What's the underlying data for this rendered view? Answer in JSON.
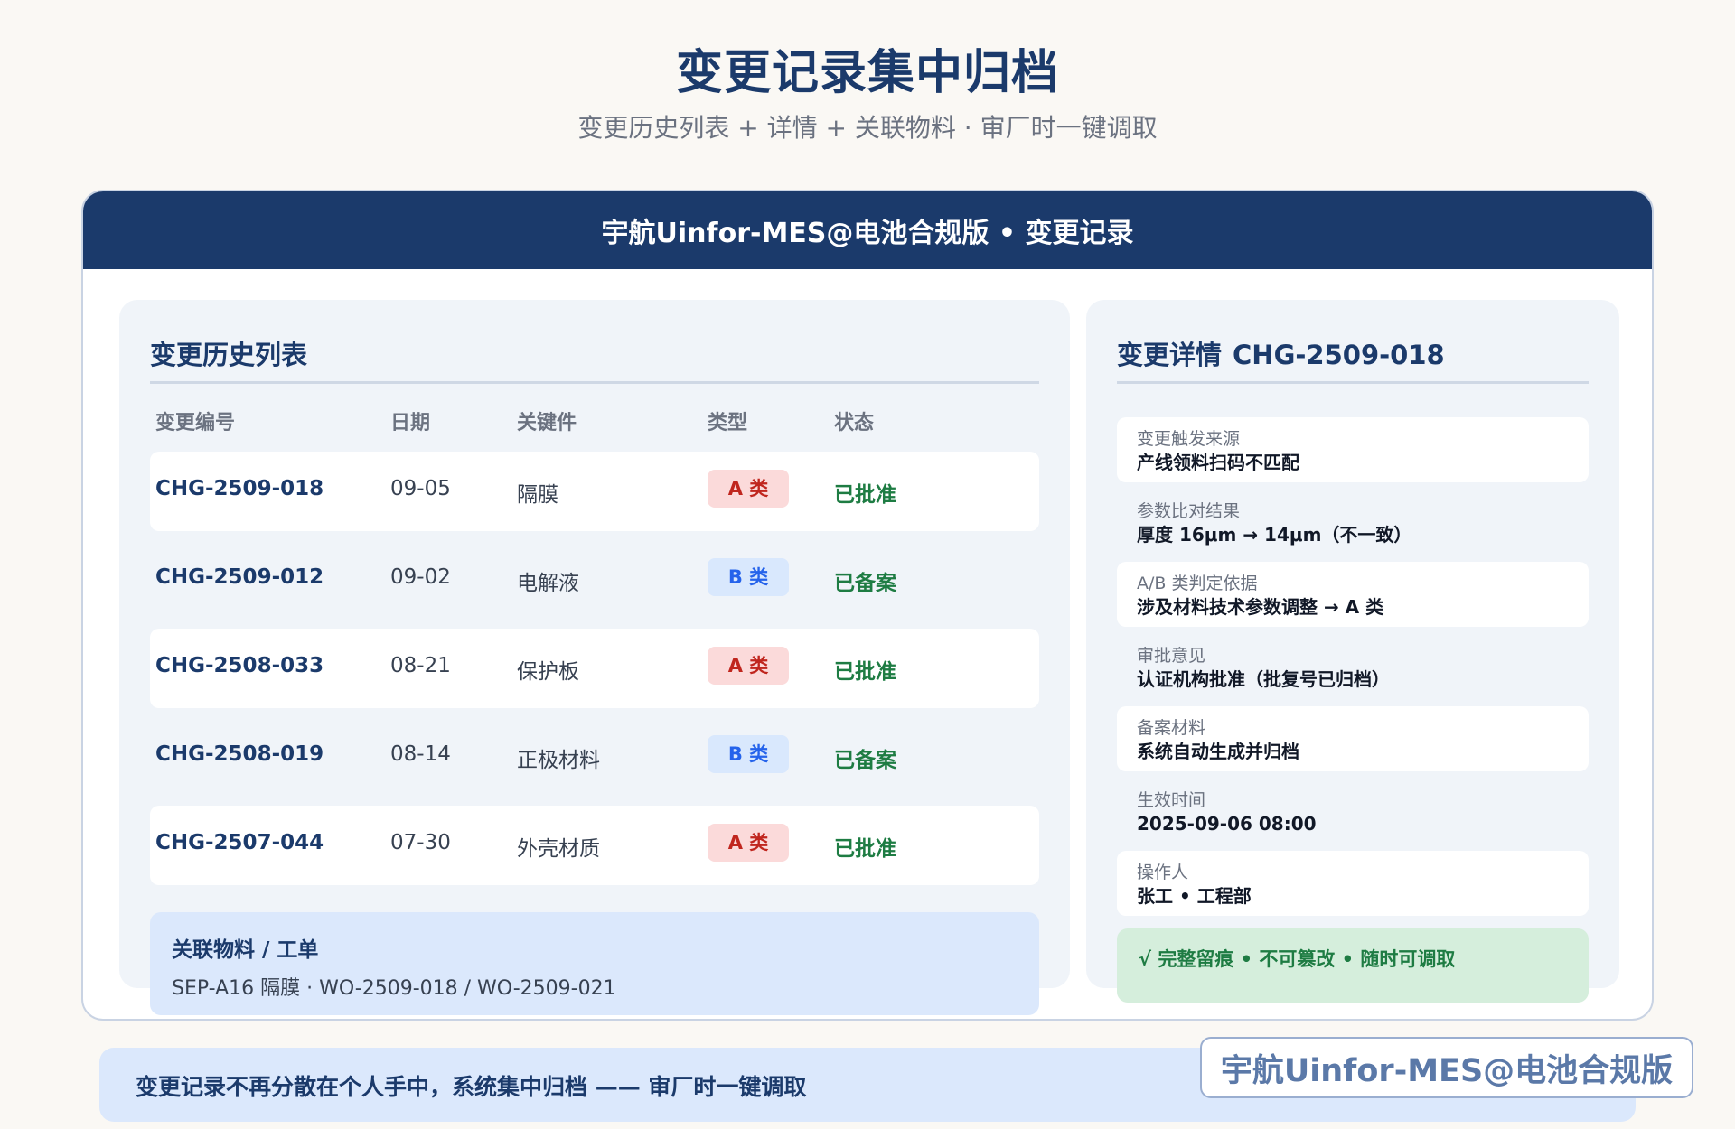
{
  "page": {
    "title": "变更记录集中归档",
    "subtitle": "变更历史列表 + 详情 + 关联物料 · 审厂时一键调取"
  },
  "card": {
    "header": "宇航Uinfor-MES@电池合规版 • 变更记录"
  },
  "history": {
    "title": "变更历史列表",
    "columns": [
      "变更编号",
      "日期",
      "关键件",
      "类型",
      "状态"
    ],
    "rows": [
      {
        "id": "CHG-2509-018",
        "date": "09-05",
        "part": "隔膜",
        "type": "A 类",
        "status": "已批准"
      },
      {
        "id": "CHG-2509-012",
        "date": "09-02",
        "part": "电解液",
        "type": "B 类",
        "status": "已备案"
      },
      {
        "id": "CHG-2508-033",
        "date": "08-21",
        "part": "保护板",
        "type": "A 类",
        "status": "已批准"
      },
      {
        "id": "CHG-2508-019",
        "date": "08-14",
        "part": "正极材料",
        "type": "B 类",
        "status": "已备案"
      },
      {
        "id": "CHG-2507-044",
        "date": "07-30",
        "part": "外壳材质",
        "type": "A 类",
        "status": "已批准"
      }
    ]
  },
  "related": {
    "title": "关联物料 / 工单",
    "text": "SEP-A16 隔膜 · WO-2509-018 / WO-2509-021"
  },
  "detail": {
    "title": "变更详情",
    "code": "CHG-2509-018",
    "items": [
      {
        "label": "变更触发来源",
        "value": "产线领料扫码不匹配"
      },
      {
        "label": "参数比对结果",
        "value": "厚度 16μm → 14μm（不一致）"
      },
      {
        "label": "A/B 类判定依据",
        "value": "涉及材料技术参数调整 → A 类"
      },
      {
        "label": "审批意见",
        "value": "认证机构批准（批复号已归档）"
      },
      {
        "label": "备案材料",
        "value": "系统自动生成并归档"
      },
      {
        "label": "生效时间",
        "value": "2025-09-06 08:00"
      },
      {
        "label": "操作人",
        "value": "张工 • 工程部"
      }
    ],
    "trace": "√ 完整留痕 • 不可篡改 • 随时可调取"
  },
  "footer": {
    "text": "变更记录不再分散在个人手中，系统集中归档 —— 审厂时一键调取",
    "brand": "宇航Uinfor-MES@电池合规版"
  },
  "colors": {
    "primary": "#1b3a6b",
    "type_a_bg": "#fbdada",
    "type_a_text": "#c0261e",
    "type_b_bg": "#d9e8fd",
    "type_b_text": "#2563eb",
    "status_green": "#1e7c43"
  }
}
